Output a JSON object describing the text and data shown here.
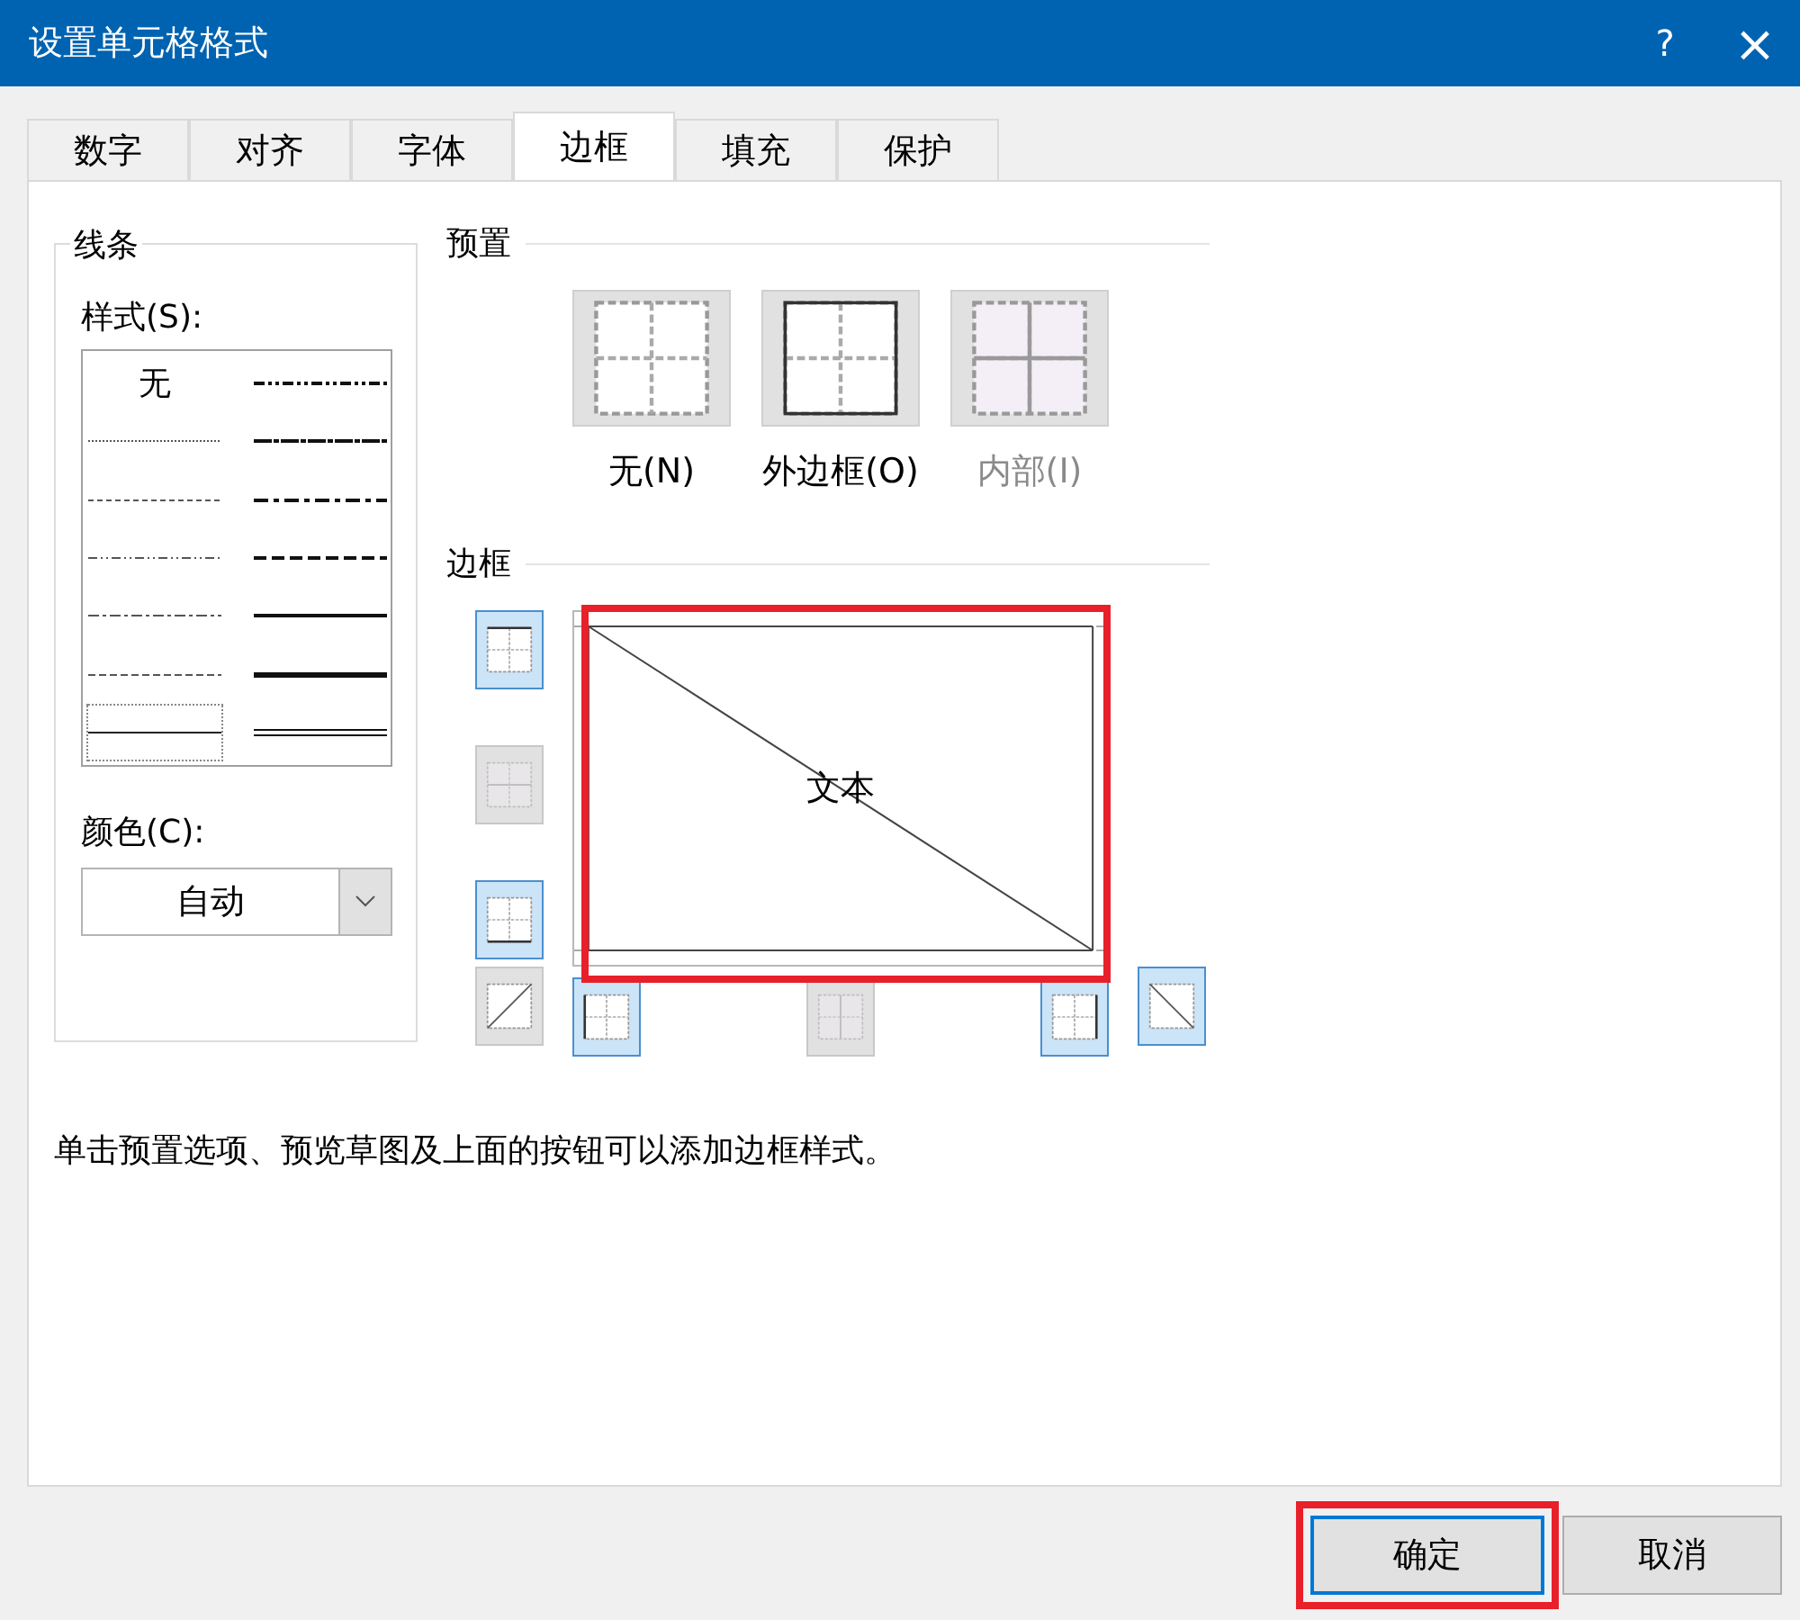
{
  "window": {
    "title": "设置单元格格式",
    "help": "?",
    "close": "×"
  },
  "tabs": [
    {
      "label": "数字",
      "selected": false
    },
    {
      "label": "对齐",
      "selected": false
    },
    {
      "label": "字体",
      "selected": false
    },
    {
      "label": "边框",
      "selected": true
    },
    {
      "label": "填充",
      "selected": false
    },
    {
      "label": "保护",
      "selected": false
    }
  ],
  "line": {
    "title": "线条",
    "style_label": "样式(S):",
    "styles": [
      {
        "kind": "none",
        "label": "无",
        "selected": false
      },
      {
        "kind": "hair",
        "selected": false
      },
      {
        "kind": "dotted",
        "selected": false
      },
      {
        "kind": "dash_dot_dot",
        "selected": false
      },
      {
        "kind": "dash_dot",
        "selected": false
      },
      {
        "kind": "dashed",
        "selected": false
      },
      {
        "kind": "thin",
        "selected": true
      },
      {
        "kind": "medium_dash_dot_dot",
        "selected": false
      },
      {
        "kind": "slanted_dash_dot",
        "selected": false
      },
      {
        "kind": "medium_dash_dot",
        "selected": false
      },
      {
        "kind": "medium_dashed",
        "selected": false
      },
      {
        "kind": "medium",
        "selected": false
      },
      {
        "kind": "thick",
        "selected": false
      },
      {
        "kind": "double",
        "selected": false
      }
    ],
    "color_label": "颜色(C):",
    "color_value": "自动"
  },
  "presets": {
    "title": "预置",
    "items": [
      {
        "kind": "none",
        "label": "无(N)",
        "disabled": false
      },
      {
        "kind": "outline",
        "label": "外边框(O)",
        "disabled": false
      },
      {
        "kind": "inside",
        "label": "内部(I)",
        "disabled": true
      }
    ]
  },
  "border": {
    "title": "边框",
    "preview_text": "文本",
    "preview_highlighted": true,
    "side_toggles": [
      {
        "kind": "top",
        "on": true,
        "disabled": false
      },
      {
        "kind": "middle_h",
        "on": false,
        "disabled": true
      },
      {
        "kind": "bottom",
        "on": true,
        "disabled": false
      }
    ],
    "bottom_toggles": [
      {
        "kind": "diag_up",
        "on": false,
        "disabled": false
      },
      {
        "kind": "left",
        "on": true,
        "disabled": false
      },
      {
        "kind": "middle_v",
        "on": false,
        "disabled": true
      },
      {
        "kind": "right",
        "on": true,
        "disabled": false
      },
      {
        "kind": "diag_down",
        "on": true,
        "disabled": false
      }
    ]
  },
  "hint": "单击预置选项、预览草图及上面的按钮可以添加边框样式。",
  "buttons": [
    {
      "kind": "ok",
      "label": "确定",
      "highlighted": true
    },
    {
      "kind": "cancel",
      "label": "取消"
    }
  ]
}
